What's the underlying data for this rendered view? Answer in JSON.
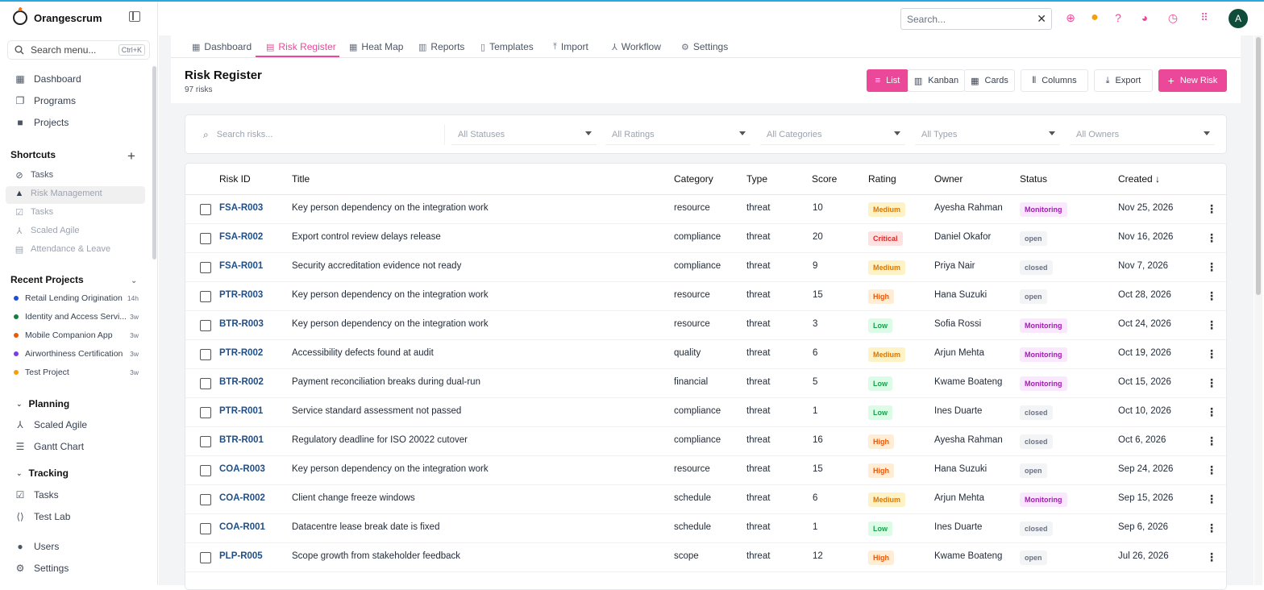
{
  "app": {
    "name": "Orangescrum"
  },
  "sidebar": {
    "search_placeholder": "Search menu...",
    "search_shortcut": "Ctrl+K",
    "main_items": [
      {
        "label": "Dashboard",
        "icon": "dashboard-icon"
      },
      {
        "label": "Programs",
        "icon": "programs-icon"
      },
      {
        "label": "Projects",
        "icon": "briefcase-icon"
      }
    ],
    "shortcuts_title": "Shortcuts",
    "shortcuts": [
      {
        "label": "Tasks",
        "icon": "check-circle-icon"
      },
      {
        "label": "Risk Management",
        "icon": "warning-icon"
      },
      {
        "label": "Tasks",
        "icon": "checklist-icon"
      },
      {
        "label": "Scaled Agile",
        "icon": "hierarchy-icon"
      },
      {
        "label": "Attendance & Leave",
        "icon": "calendar-icon"
      }
    ],
    "recent_title": "Recent Projects",
    "recent_projects": [
      {
        "name": "Retail Lending Origination",
        "age": "14h",
        "color": "#1d4ed8"
      },
      {
        "name": "Identity and Access Servi...",
        "age": "3w",
        "color": "#15803d"
      },
      {
        "name": "Mobile Companion App",
        "age": "3w",
        "color": "#ea580c"
      },
      {
        "name": "Airworthiness Certification",
        "age": "3w",
        "color": "#7c3aed"
      },
      {
        "name": "Test Project",
        "age": "3w",
        "color": "#f59e0b"
      }
    ],
    "planning_title": "Planning",
    "planning_items": [
      {
        "label": "Scaled Agile",
        "icon": "hierarchy-icon"
      },
      {
        "label": "Gantt Chart",
        "icon": "gantt-icon"
      }
    ],
    "tracking_title": "Tracking",
    "tracking_items": [
      {
        "label": "Tasks",
        "icon": "checklist-icon"
      },
      {
        "label": "Test Lab",
        "icon": "code-icon"
      }
    ],
    "bottom_items": [
      {
        "label": "Users",
        "icon": "user-icon"
      },
      {
        "label": "Settings",
        "icon": "gear-icon"
      }
    ]
  },
  "topbar": {
    "search_placeholder": "Search...",
    "avatar_initial": "A"
  },
  "tabs": [
    {
      "label": "Dashboard",
      "icon": "dashboard-icon"
    },
    {
      "label": "Risk Register",
      "icon": "document-icon",
      "active": true
    },
    {
      "label": "Heat Map",
      "icon": "grid-icon"
    },
    {
      "label": "Reports",
      "icon": "bar-chart-icon"
    },
    {
      "label": "Templates",
      "icon": "template-icon"
    },
    {
      "label": "Import",
      "icon": "upload-icon"
    },
    {
      "label": "Workflow",
      "icon": "workflow-icon"
    },
    {
      "label": "Settings",
      "icon": "gear-icon"
    }
  ],
  "page": {
    "title": "Risk Register",
    "subtitle": "97 risks",
    "view_list": "List",
    "view_kanban": "Kanban",
    "view_cards": "Cards",
    "columns_btn": "Columns",
    "export_btn": "Export",
    "new_btn": "New Risk"
  },
  "filters": {
    "search_placeholder": "Search risks...",
    "statuses": "All Statuses",
    "ratings": "All Ratings",
    "categories": "All Categories",
    "types": "All Types",
    "owners": "All Owners"
  },
  "table": {
    "headers": {
      "id": "Risk ID",
      "title": "Title",
      "category": "Category",
      "type": "Type",
      "score": "Score",
      "rating": "Rating",
      "owner": "Owner",
      "status": "Status",
      "created": "Created"
    },
    "rows": [
      {
        "id": "FSA-R003",
        "title": "Key person dependency on the integration work",
        "category": "resource",
        "type": "threat",
        "score": "10",
        "rating": "Medium",
        "owner": "Ayesha Rahman",
        "status": "Monitoring",
        "created": "Nov 25, 2026"
      },
      {
        "id": "FSA-R002",
        "title": "Export control review delays release",
        "category": "compliance",
        "type": "threat",
        "score": "20",
        "rating": "Critical",
        "owner": "Daniel Okafor",
        "status": "open",
        "created": "Nov 16, 2026"
      },
      {
        "id": "FSA-R001",
        "title": "Security accreditation evidence not ready",
        "category": "compliance",
        "type": "threat",
        "score": "9",
        "rating": "Medium",
        "owner": "Priya Nair",
        "status": "closed",
        "created": "Nov 7, 2026"
      },
      {
        "id": "PTR-R003",
        "title": "Key person dependency on the integration work",
        "category": "resource",
        "type": "threat",
        "score": "15",
        "rating": "High",
        "owner": "Hana Suzuki",
        "status": "open",
        "created": "Oct 28, 2026"
      },
      {
        "id": "BTR-R003",
        "title": "Key person dependency on the integration work",
        "category": "resource",
        "type": "threat",
        "score": "3",
        "rating": "Low",
        "owner": "Sofia Rossi",
        "status": "Monitoring",
        "created": "Oct 24, 2026"
      },
      {
        "id": "PTR-R002",
        "title": "Accessibility defects found at audit",
        "category": "quality",
        "type": "threat",
        "score": "6",
        "rating": "Medium",
        "owner": "Arjun Mehta",
        "status": "Monitoring",
        "created": "Oct 19, 2026"
      },
      {
        "id": "BTR-R002",
        "title": "Payment reconciliation breaks during dual-run",
        "category": "financial",
        "type": "threat",
        "score": "5",
        "rating": "Low",
        "owner": "Kwame Boateng",
        "status": "Monitoring",
        "created": "Oct 15, 2026"
      },
      {
        "id": "PTR-R001",
        "title": "Service standard assessment not passed",
        "category": "compliance",
        "type": "threat",
        "score": "1",
        "rating": "Low",
        "owner": "Ines Duarte",
        "status": "closed",
        "created": "Oct 10, 2026"
      },
      {
        "id": "BTR-R001",
        "title": "Regulatory deadline for ISO 20022 cutover",
        "category": "compliance",
        "type": "threat",
        "score": "16",
        "rating": "High",
        "owner": "Ayesha Rahman",
        "status": "closed",
        "created": "Oct 6, 2026"
      },
      {
        "id": "COA-R003",
        "title": "Key person dependency on the integration work",
        "category": "resource",
        "type": "threat",
        "score": "15",
        "rating": "High",
        "owner": "Hana Suzuki",
        "status": "open",
        "created": "Sep 24, 2026"
      },
      {
        "id": "COA-R002",
        "title": "Client change freeze windows",
        "category": "schedule",
        "type": "threat",
        "score": "6",
        "rating": "Medium",
        "owner": "Arjun Mehta",
        "status": "Monitoring",
        "created": "Sep 15, 2026"
      },
      {
        "id": "COA-R001",
        "title": "Datacentre lease break date is fixed",
        "category": "schedule",
        "type": "threat",
        "score": "1",
        "rating": "Low",
        "owner": "Ines Duarte",
        "status": "closed",
        "created": "Sep 6, 2026"
      },
      {
        "id": "PLP-R005",
        "title": "Scope growth from stakeholder feedback",
        "category": "scope",
        "type": "threat",
        "score": "12",
        "rating": "High",
        "owner": "Kwame Boateng",
        "status": "open",
        "created": "Jul 26, 2026"
      }
    ]
  },
  "colors": {
    "accent": "#ec4899",
    "rating_medium": "#d97706",
    "rating_high": "#ea580c",
    "rating_low": "#16a34a",
    "rating_critical": "#dc2626",
    "status_monitoring": "#a21caf",
    "status_muted": "#6b7280",
    "link": "#1e4f8a"
  }
}
